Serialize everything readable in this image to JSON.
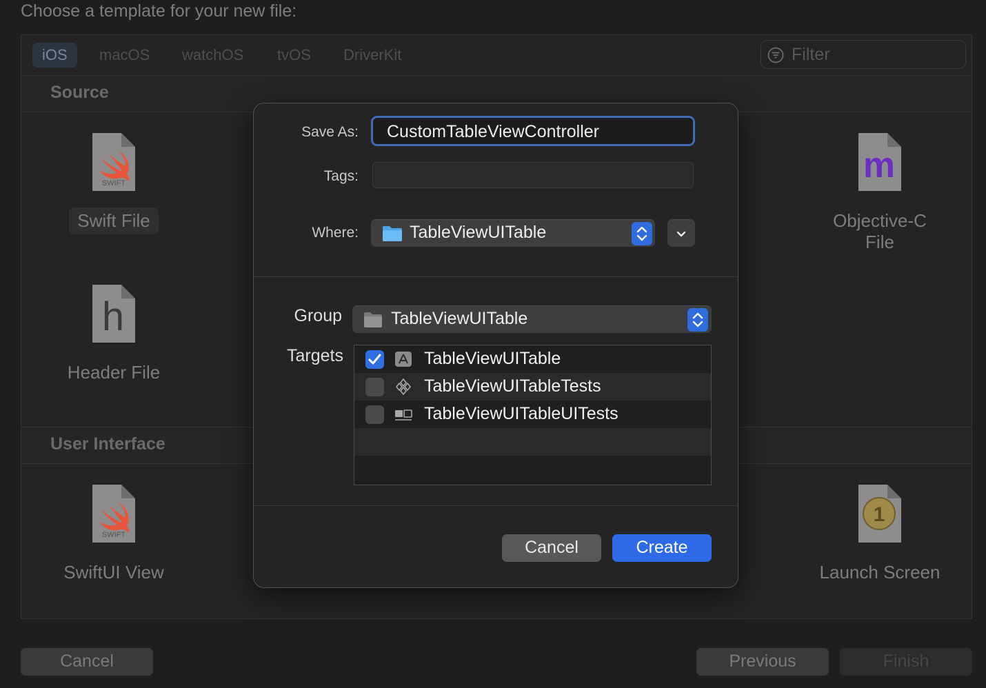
{
  "window": {
    "title": "Choose a template for your new file:"
  },
  "platform_tabs": [
    {
      "label": "iOS",
      "active": true
    },
    {
      "label": "macOS",
      "active": false
    },
    {
      "label": "watchOS",
      "active": false
    },
    {
      "label": "tvOS",
      "active": false
    },
    {
      "label": "DriverKit",
      "active": false
    }
  ],
  "filter": {
    "placeholder": "Filter",
    "icon": "filter-icon"
  },
  "sections": {
    "source": {
      "label": "Source",
      "templates": [
        {
          "label": "Swift File",
          "icon": "swift-file-icon",
          "icon_text": "SWIFT",
          "selected": true
        },
        {
          "label": "Objective-C File",
          "icon": "objc-file-icon",
          "icon_text": "m"
        },
        {
          "label": "Header File",
          "icon": "header-file-icon",
          "icon_text": "h"
        }
      ]
    },
    "user_interface": {
      "label": "User Interface",
      "templates": [
        {
          "label": "SwiftUI View",
          "icon": "swiftui-file-icon",
          "icon_text": "SWIFT"
        },
        {
          "label": "Launch Screen",
          "icon": "launch-screen-icon",
          "icon_text": "1"
        }
      ]
    }
  },
  "footer": {
    "cancel_label": "Cancel",
    "previous_label": "Previous",
    "finish_label": "Finish"
  },
  "sheet": {
    "save_as_label": "Save As:",
    "save_as_value": "CustomTableViewController",
    "tags_label": "Tags:",
    "tags_value": "",
    "where_label": "Where:",
    "where_value": "TableViewUITable",
    "group_label": "Group",
    "group_value": "TableViewUITable",
    "targets_label": "Targets",
    "targets": [
      {
        "name": "TableViewUITable",
        "checked": true,
        "icon": "app-target-icon"
      },
      {
        "name": "TableViewUITableTests",
        "checked": false,
        "icon": "unit-test-target-icon"
      },
      {
        "name": "TableViewUITableUITests",
        "checked": false,
        "icon": "ui-test-target-icon"
      }
    ],
    "cancel_label": "Cancel",
    "create_label": "Create"
  },
  "colors": {
    "accent": "#2e6ae6",
    "focus_ring": "#3e6bb3",
    "swift_orange": "#e8553a",
    "objc_purple": "#6b2fbf"
  }
}
